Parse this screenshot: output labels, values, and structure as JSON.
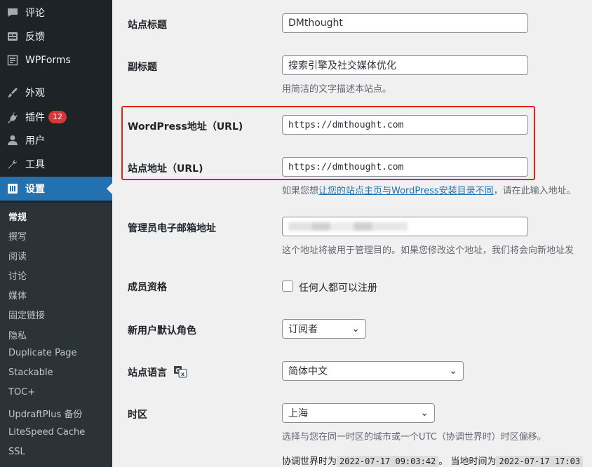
{
  "sidebar": {
    "items": [
      {
        "label": "评论",
        "icon": "comment-icon"
      },
      {
        "label": "反馈",
        "icon": "feedback-icon"
      },
      {
        "label": "WPForms",
        "icon": "wpforms-icon"
      },
      {
        "label": "外观",
        "icon": "appearance-icon"
      },
      {
        "label": "插件",
        "icon": "plugins-icon",
        "badge": "12"
      },
      {
        "label": "用户",
        "icon": "users-icon"
      },
      {
        "label": "工具",
        "icon": "tools-icon"
      },
      {
        "label": "设置",
        "icon": "settings-icon",
        "active": true
      }
    ],
    "submenu": [
      "常规",
      "撰写",
      "阅读",
      "讨论",
      "媒体",
      "固定链接",
      "隐私",
      "Duplicate Page",
      "Stackable",
      "TOC+",
      "UpdraftPlus 备份",
      "LiteSpeed Cache",
      "SSL"
    ]
  },
  "form": {
    "site_title": {
      "label": "站点标题",
      "value": "DMthought"
    },
    "tagline": {
      "label": "副标题",
      "value": "搜索引擎及社交媒体优化",
      "desc": "用简洁的文字描述本站点。"
    },
    "wp_url": {
      "label": "WordPress地址（URL)",
      "value": "https://dmthought.com"
    },
    "site_url": {
      "label": "站点地址（URL)",
      "value": "https://dmthought.com",
      "desc_prefix": "如果您想",
      "desc_link": "让您的站点主页与WordPress安装目录不同",
      "desc_suffix": "，请在此输入地址。"
    },
    "admin_email": {
      "label": "管理员电子邮箱地址",
      "desc": "这个地址将被用于管理目的。如果您修改这个地址，我们将会向新地址发"
    },
    "membership": {
      "label": "成员资格",
      "checkbox_label": "任何人都可以注册"
    },
    "default_role": {
      "label": "新用户默认角色",
      "value": "订阅者"
    },
    "site_language": {
      "label": "站点语言",
      "value": "简体中文"
    },
    "timezone": {
      "label": "时区",
      "value": "上海",
      "desc": "选择与您在同一时区的城市或一个UTC（协调世界时）时区偏移。"
    },
    "time_info": {
      "utc_prefix": "协调世界时为",
      "utc_time": "2022-07-17 09:03:42",
      "sep": "。",
      "local_prefix": "当地时间为",
      "local_time": "2022-07-17 17:03"
    }
  },
  "colors": {
    "accent": "#2271b1",
    "highlight": "#e5211f",
    "sidebar": "#1d2327"
  }
}
